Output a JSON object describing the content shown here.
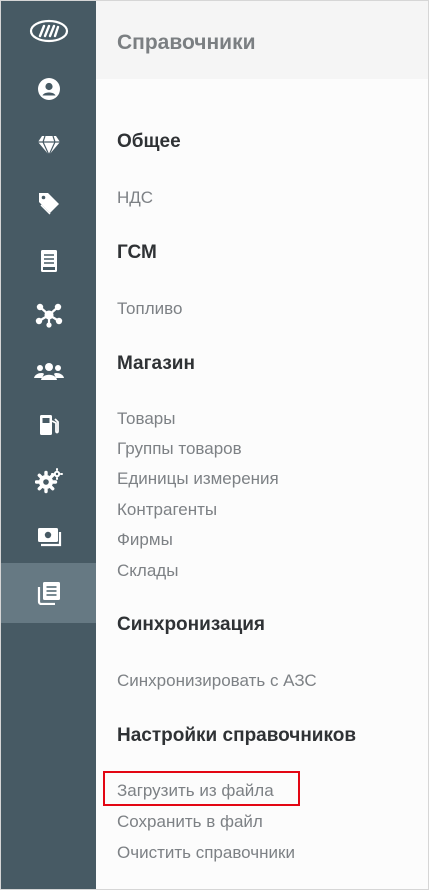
{
  "panel": {
    "title": "Справочники"
  },
  "rail": {
    "items": [
      {
        "icon": "logo-icon"
      },
      {
        "icon": "user-icon"
      },
      {
        "icon": "diamond-icon"
      },
      {
        "icon": "tag-icon"
      },
      {
        "icon": "receipt-icon"
      },
      {
        "icon": "network-icon"
      },
      {
        "icon": "users-icon"
      },
      {
        "icon": "fuel-icon"
      },
      {
        "icon": "settings-icon"
      },
      {
        "icon": "cash-icon"
      },
      {
        "icon": "reference-book-icon",
        "active": true
      }
    ]
  },
  "sections": [
    {
      "heading": "Общее",
      "links": [
        "НДС"
      ]
    },
    {
      "heading": "ГСМ",
      "links": [
        "Топливо"
      ]
    },
    {
      "heading": "Магазин",
      "links": [
        "Товары",
        "Группы товаров",
        "Единицы измерения",
        "Контрагенты",
        "Фирмы",
        "Склады"
      ]
    },
    {
      "heading": "Синхронизация",
      "links": [
        "Синхронизировать с АЗС"
      ]
    },
    {
      "heading": "Настройки справочников",
      "links": [
        "Загрузить из файла",
        "Сохранить в файл",
        "Очистить справочники"
      ]
    }
  ],
  "colors": {
    "rail_bg": "#475a64",
    "rail_active": "#667983",
    "highlight": "#e30613"
  }
}
